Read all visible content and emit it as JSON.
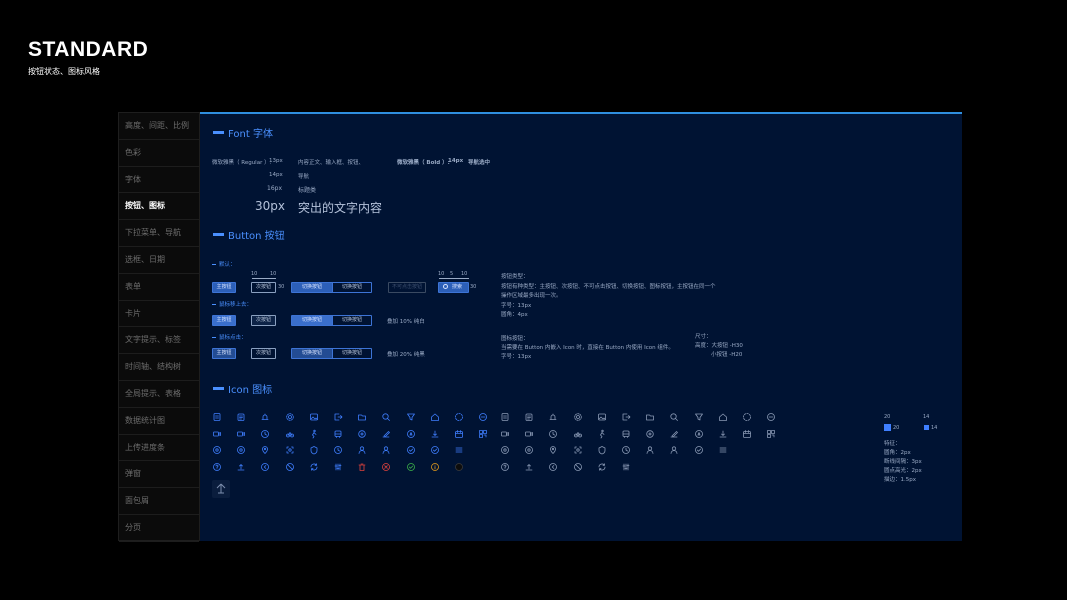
{
  "header": {
    "title": "STANDARD",
    "subtitle": "按钮状态、图标风格"
  },
  "sidebar": {
    "items": [
      {
        "label": "高度、间距、比例"
      },
      {
        "label": "色彩"
      },
      {
        "label": "字体"
      },
      {
        "label": "按钮、图标",
        "active": true
      },
      {
        "label": "下拉菜单、导航"
      },
      {
        "label": "选框、日期"
      },
      {
        "label": "表单"
      },
      {
        "label": "卡片"
      },
      {
        "label": "文字提示、标签"
      },
      {
        "label": "时间轴、结构树"
      },
      {
        "label": "全局提示、表格"
      },
      {
        "label": "数据统计图"
      },
      {
        "label": "上传进度条"
      },
      {
        "label": "弹窗"
      },
      {
        "label": "面包屑"
      },
      {
        "label": "分页"
      }
    ]
  },
  "font_section": {
    "title": "Font 字体",
    "regular_label": "微软雅黑（ Regular ）:",
    "rows": [
      {
        "size": "13px",
        "desc": "内容正文、输入框、按钮、"
      },
      {
        "size": "14px",
        "desc": "导航"
      },
      {
        "size": "16px",
        "desc": "标题类"
      },
      {
        "size": "30px",
        "desc": "突出的文字内容"
      }
    ],
    "bold_label": "微软雅黑（ Bold ）:",
    "bold_size": "14px",
    "bold_desc": "导航选中"
  },
  "button_section": {
    "title": "Button 按钮",
    "state_default": "默认：",
    "state_hover": "鼠标移上去：",
    "state_click": "鼠标点击：",
    "primary": "主按钮",
    "secondary": "次按钮",
    "switch": "切换按钮",
    "disabled": "不可点击按钮",
    "search": "搜索",
    "dim_10": "10",
    "dim_5": "5",
    "dim_30": "30",
    "hover_note": "叠加 10% 纯白",
    "click_note": "叠加 20% 纯黑",
    "types_title": "按钮类型：",
    "types_line1": "按钮有种类型：主按钮、次按钮、不可点击按钮、切换按钮、图标按钮，主按钮在同一个",
    "types_line2": "操作区域最多出现一次。",
    "types_font": "字号：13px",
    "types_radius": "圆角：4px",
    "icon_btn_title": "图标按钮：",
    "icon_btn_line": "当需要在 Button 内嵌入 Icon 时，直接在 Button 内使用 Icon 组件。",
    "icon_btn_font": "字号：13px",
    "size_title": "尺寸：",
    "size_large": "高度：大按钮 -H30",
    "size_small": "小按钮 -H20"
  },
  "icon_section": {
    "title": "Icon 图标",
    "spec_20a": "20",
    "spec_20b": "20",
    "spec_14a": "14",
    "spec_14b": "14",
    "features_title": "特征：",
    "feature_radius": "圆角：2px",
    "feature_gap": "断线间隔：3px",
    "feature_dot": "圆点高光：2px",
    "feature_stroke": "描边：1.5px"
  },
  "colors": {
    "accent": "#4a90ff",
    "panel": "#001333",
    "primary_btn": "#2c5fb8",
    "danger": "#e0433d",
    "success": "#3bb34a",
    "warning": "#e39a1b"
  }
}
